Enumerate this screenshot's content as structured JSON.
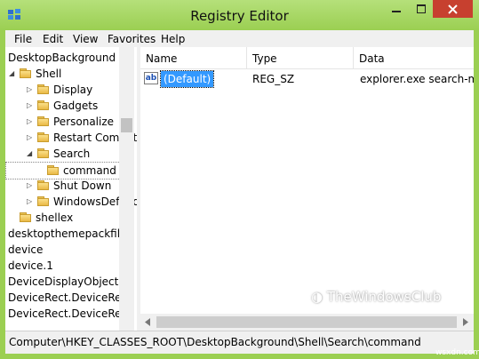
{
  "window": {
    "title": "Registry Editor",
    "colors": {
      "frame": "#9bcf52",
      "close": "#c7402f",
      "selection": "#3399ff"
    }
  },
  "menu": [
    "File",
    "Edit",
    "View",
    "Favorites",
    "Help"
  ],
  "tree": {
    "items": [
      {
        "label": "DesktopBackground",
        "expander": "",
        "icon": ""
      },
      {
        "label": "Shell",
        "expander": "◢",
        "icon": "folder-icon"
      },
      {
        "label": "Display",
        "expander": "▷",
        "icon": "folder-icon"
      },
      {
        "label": "Gadgets",
        "expander": "▷",
        "icon": "folder-icon"
      },
      {
        "label": "Personalize",
        "expander": "▷",
        "icon": "folder-icon"
      },
      {
        "label": "Restart Compute",
        "expander": "▷",
        "icon": "folder-icon"
      },
      {
        "label": "Search",
        "expander": "◢",
        "icon": "folder-icon"
      },
      {
        "label": "command",
        "expander": "",
        "icon": "folder-icon"
      },
      {
        "label": "Shut Down",
        "expander": "▷",
        "icon": "folder-icon"
      },
      {
        "label": "WindowsDefend",
        "expander": "▷",
        "icon": "folder-icon"
      },
      {
        "label": "shellex",
        "expander": "",
        "icon": "folder-icon"
      },
      {
        "label": "desktopthemepackfile",
        "expander": "",
        "icon": ""
      },
      {
        "label": "device",
        "expander": "",
        "icon": ""
      },
      {
        "label": "device.1",
        "expander": "",
        "icon": ""
      },
      {
        "label": "DeviceDisplayObject",
        "expander": "",
        "icon": ""
      },
      {
        "label": "DeviceRect.DeviceRect",
        "expander": "",
        "icon": ""
      },
      {
        "label": "DeviceRect.DeviceRect",
        "expander": "",
        "icon": ""
      }
    ]
  },
  "list": {
    "columns": [
      "Name",
      "Type",
      "Data"
    ],
    "rows": [
      {
        "icon": "ab",
        "name": "(Default)",
        "type": "REG_SZ",
        "data": "explorer.exe search-ms:"
      }
    ]
  },
  "watermark": "TheWindowsClub",
  "status": "Computer\\HKEY_CLASSES_ROOT\\DesktopBackground\\Shell\\Search\\command",
  "corner_watermark": "wsxdn.com"
}
